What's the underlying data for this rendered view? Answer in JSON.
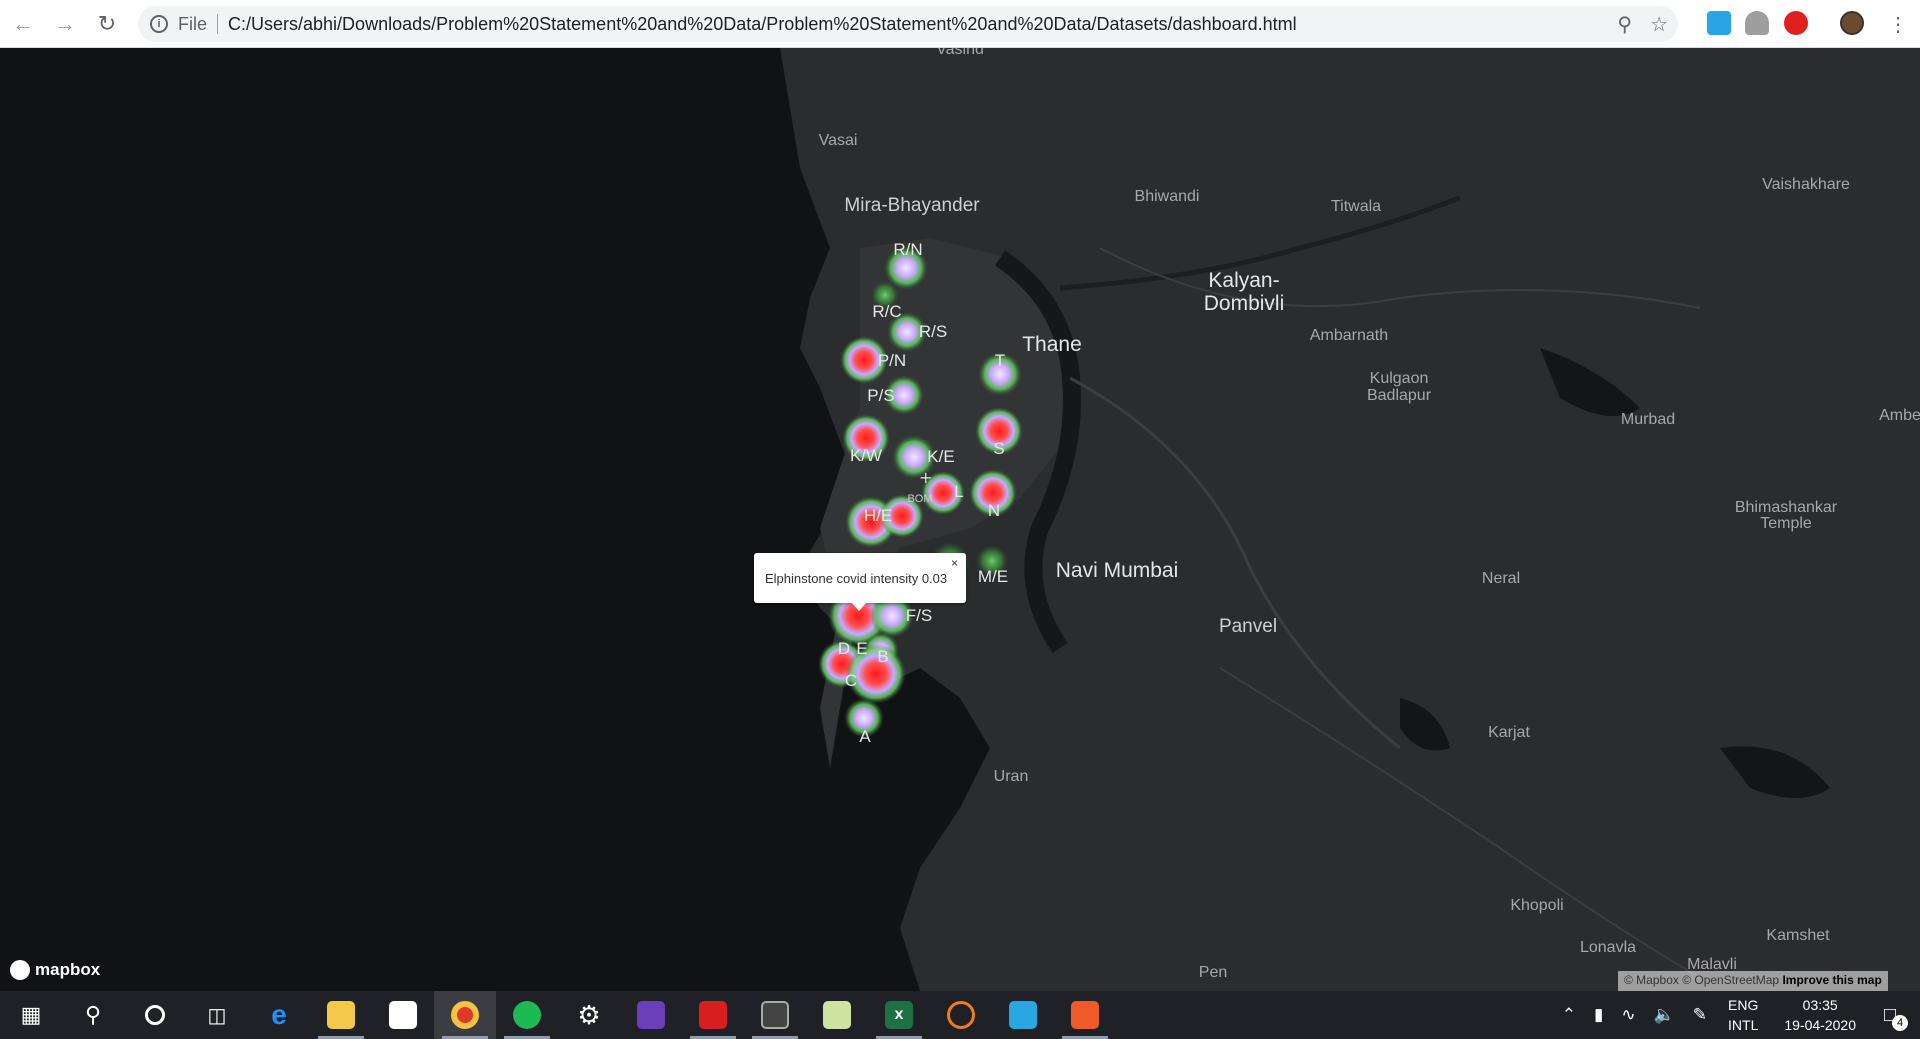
{
  "browser": {
    "scheme": "File",
    "url": "C:/Users/abhi/Downloads/Problem%20Statement%20and%20Data/Problem%20Statement%20and%20Data/Datasets/dashboard.html"
  },
  "map": {
    "places": [
      {
        "name": "Vasind",
        "size": "small"
      },
      {
        "name": "Vasai",
        "size": "small"
      },
      {
        "name": "Mira-Bhayander",
        "size": "mid"
      },
      {
        "name": "Bhiwandi",
        "size": "small"
      },
      {
        "name": "Titwala",
        "size": "small"
      },
      {
        "name": "Vaishakhare",
        "size": "small"
      },
      {
        "name": "Kalyan-",
        "size": "big"
      },
      {
        "name": "Dombivli",
        "size": "big"
      },
      {
        "name": "Thane",
        "size": "big"
      },
      {
        "name": "Ambarnath",
        "size": "small"
      },
      {
        "name": "Kulgaon",
        "size": "small"
      },
      {
        "name": "Badlapur",
        "size": "small"
      },
      {
        "name": "Murbad",
        "size": "small"
      },
      {
        "name": "Ambe",
        "size": "small"
      },
      {
        "name": "Bhimashankar",
        "size": "small"
      },
      {
        "name": "Temple",
        "size": "small"
      },
      {
        "name": "Navi Mumbai",
        "size": "big"
      },
      {
        "name": "Neral",
        "size": "small"
      },
      {
        "name": "Panvel",
        "size": "mid"
      },
      {
        "name": "Karjat",
        "size": "small"
      },
      {
        "name": "Uran",
        "size": "small"
      },
      {
        "name": "Khopoli",
        "size": "small"
      },
      {
        "name": "Kamshet",
        "size": "small"
      },
      {
        "name": "Lonavla",
        "size": "small"
      },
      {
        "name": "Malavli",
        "size": "small"
      },
      {
        "name": "Pen",
        "size": "small"
      }
    ],
    "wards": [
      "R/N",
      "R/C",
      "R/S",
      "P/N",
      "P/S",
      "K/W",
      "K/E",
      "T",
      "S",
      "L",
      "N",
      "H/E",
      "M/E",
      "F/S",
      "D",
      "E",
      "B",
      "C",
      "A"
    ],
    "airport": {
      "code": "BOM"
    },
    "popup": {
      "text": "Elphinstone covid intensity 0.03",
      "close": "×"
    },
    "logo": "mapbox",
    "attribution": {
      "text": "© Mapbox © OpenStreetMap",
      "link": "Improve this map"
    },
    "colors": {
      "hot": "#ff1a1a",
      "warm": "#d7b4ff",
      "glow": "#6ad36a"
    }
  },
  "taskbar": {
    "apps": [
      "start",
      "search",
      "cortana",
      "task-view",
      "edge",
      "file-explorer",
      "store",
      "chrome",
      "spotify",
      "settings",
      "app-film",
      "acrobat",
      "terminal",
      "app-paint",
      "excel",
      "app-orange",
      "app-arrow",
      "app-camera"
    ],
    "tray": {
      "lang_top": "ENG",
      "lang_bottom": "INTL",
      "time": "03:35",
      "date": "19-04-2020",
      "notifications": "4"
    }
  }
}
